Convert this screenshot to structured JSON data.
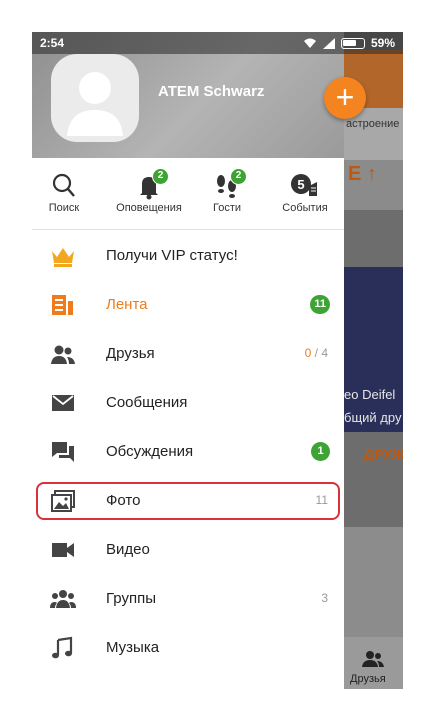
{
  "status_bar": {
    "time": "2:54",
    "battery": "59%"
  },
  "profile": {
    "name": "ATEM Schwarz"
  },
  "fab": {
    "label": "+"
  },
  "quick_actions": [
    {
      "label": "Поиск",
      "icon": "search-icon"
    },
    {
      "label": "Оповещения",
      "icon": "bell-icon",
      "badge": "2"
    },
    {
      "label": "Гости",
      "icon": "footprints-icon",
      "badge": "2"
    },
    {
      "label": "События",
      "icon": "events-icon",
      "badge": "5"
    }
  ],
  "menu": [
    {
      "label": "Получи VIP статус!",
      "icon": "crown-icon"
    },
    {
      "label": "Лента",
      "icon": "feed-icon",
      "badge": "11",
      "active": true
    },
    {
      "label": "Друзья",
      "icon": "friends-icon",
      "count_online": "0",
      "count_total": "/ 4"
    },
    {
      "label": "Сообщения",
      "icon": "envelope-icon"
    },
    {
      "label": "Обсуждения",
      "icon": "discussions-icon",
      "badge": "1"
    },
    {
      "label": "Фото",
      "icon": "photo-icon",
      "count": "11",
      "highlighted": true
    },
    {
      "label": "Видео",
      "icon": "video-icon"
    },
    {
      "label": "Группы",
      "icon": "groups-icon",
      "count": "3"
    },
    {
      "label": "Музыка",
      "icon": "music-icon"
    }
  ],
  "background_app": {
    "status_partial": "астроение",
    "card_partial": "Е ↑",
    "photo_text_line1": "eo Deifel",
    "photo_text_line2": "бщий дру",
    "button_partial": "ДРУЖ",
    "bottom_nav_label": "Друзья"
  },
  "colors": {
    "accent": "#ef7b1b",
    "badge": "#3ea335",
    "highlight": "#d8323a"
  }
}
